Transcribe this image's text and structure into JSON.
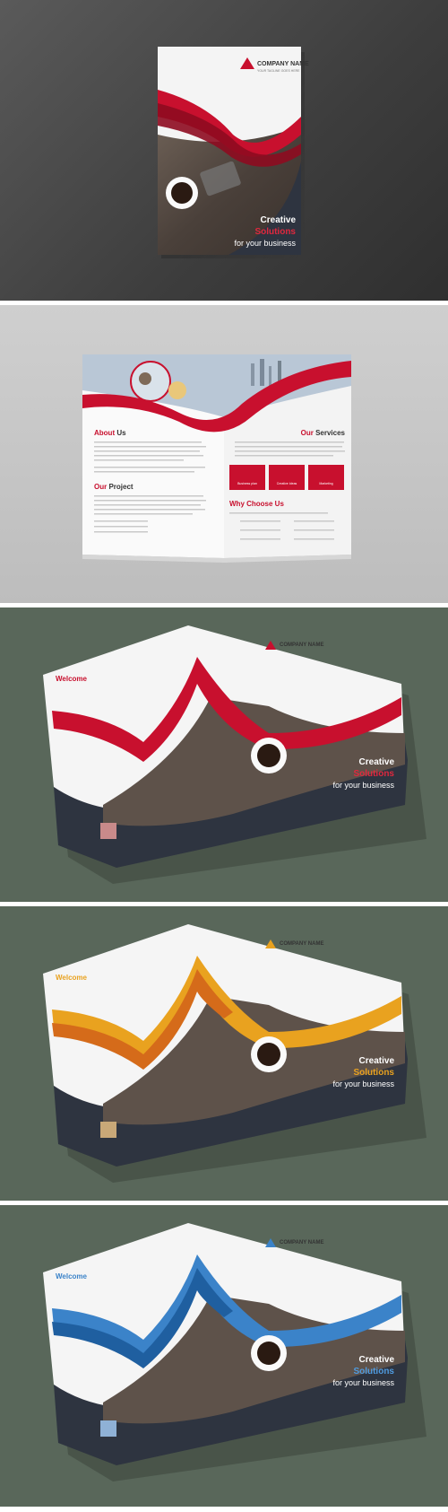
{
  "cover": {
    "company_name": "COMPANY NAME",
    "tagline": "YOUR TAGLINE GOES HERE",
    "headline_1": "Creative",
    "headline_2": "Solutions",
    "headline_3": "for your business"
  },
  "inner": {
    "about_us_1": "About",
    "about_us_2": "Us",
    "our_project_1": "Our",
    "our_project_2": "Project",
    "our_services_1": "Our",
    "our_services_2": "Services",
    "why_choose_us": "Why Choose Us",
    "service_1": "Business plan",
    "service_2": "Creative Ideas",
    "service_3": "Marketing"
  },
  "back": {
    "welcome": "Welcome"
  },
  "colors": {
    "red": "#c8102e",
    "orange": "#e9a21f",
    "blue": "#3b83c9",
    "dark": "#2e3440"
  }
}
